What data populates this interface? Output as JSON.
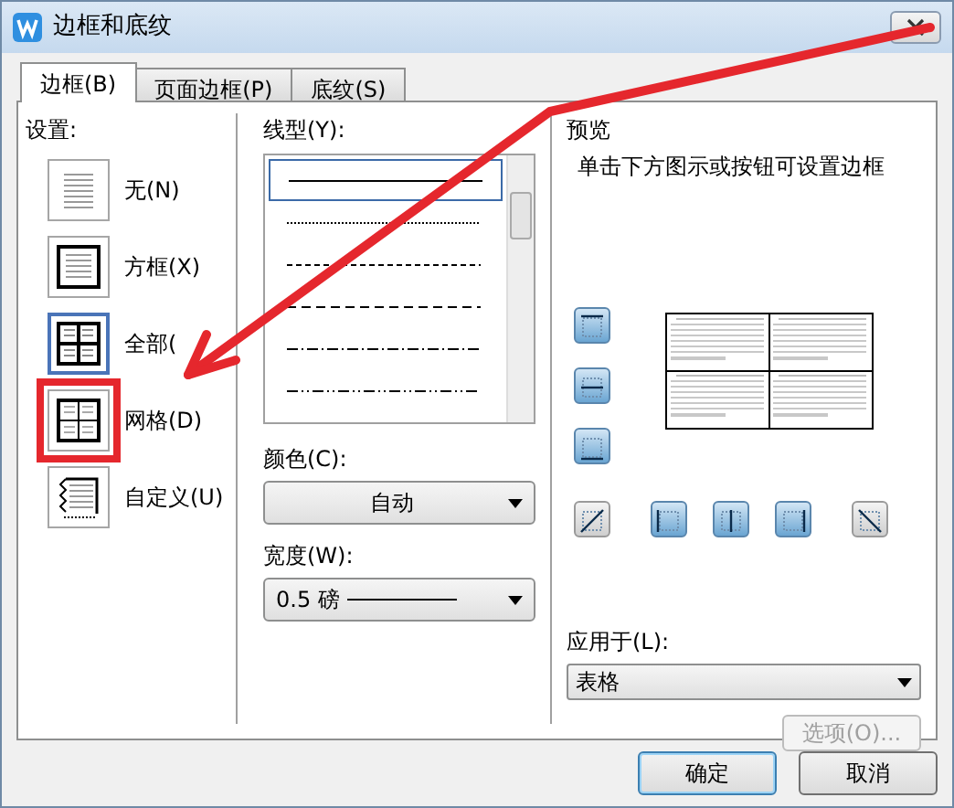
{
  "window": {
    "title": "边框和底纹"
  },
  "tabs": [
    {
      "label": "边框(B)",
      "selected": true
    },
    {
      "label": "页面边框(P)",
      "selected": false
    },
    {
      "label": "底纹(S)",
      "selected": false
    }
  ],
  "settings": {
    "label": "设置:",
    "items": [
      {
        "kind": "none",
        "label": "无(N)",
        "selected": false,
        "highlighted": false
      },
      {
        "kind": "box",
        "label": "方框(X)",
        "selected": false,
        "highlighted": false
      },
      {
        "kind": "all",
        "label": "全部(",
        "selected": true,
        "highlighted": false
      },
      {
        "kind": "grid",
        "label": "网格(D)",
        "selected": false,
        "highlighted": true
      },
      {
        "kind": "custom",
        "label": "自定义(U)",
        "selected": false,
        "highlighted": false
      }
    ]
  },
  "line_style": {
    "label": "线型(Y):",
    "items": [
      {
        "kind": "solid",
        "selected": true
      },
      {
        "kind": "dotted",
        "selected": false
      },
      {
        "kind": "dashed",
        "selected": false
      },
      {
        "kind": "dash-long",
        "selected": false
      },
      {
        "kind": "dash-dot",
        "selected": false
      },
      {
        "kind": "dash-dot-dot",
        "selected": false
      }
    ]
  },
  "color": {
    "label": "颜色(C):",
    "value": "自动"
  },
  "width": {
    "label": "宽度(W):",
    "value": "0.5 磅"
  },
  "preview": {
    "label": "预览",
    "hint": "单击下方图示或按钮可设置边框",
    "side_buttons": [
      {
        "kind": "top",
        "on": true
      },
      {
        "kind": "middle-h",
        "on": true
      },
      {
        "kind": "bottom",
        "on": true
      }
    ],
    "bottom_buttons": [
      {
        "kind": "diag-up",
        "on": false
      },
      {
        "kind": "left",
        "on": true
      },
      {
        "kind": "middle-v",
        "on": true
      },
      {
        "kind": "right",
        "on": true
      },
      {
        "kind": "diag-down",
        "on": false
      }
    ]
  },
  "apply_to": {
    "label": "应用于(L):",
    "value": "表格"
  },
  "options_button": {
    "label": "选项(O)...",
    "disabled": true
  },
  "buttons": [
    {
      "label": "确定",
      "default": true
    },
    {
      "label": "取消",
      "default": false
    }
  ]
}
